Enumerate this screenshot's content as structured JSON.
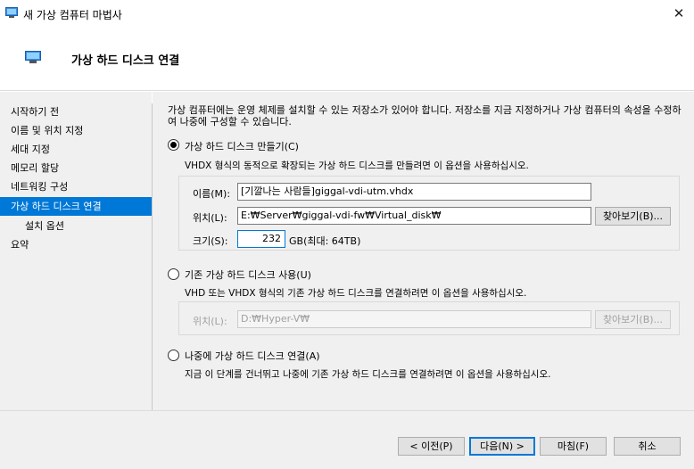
{
  "window": {
    "title": "새 가상 컴퓨터 마법사",
    "close_glyph": "✕"
  },
  "header": {
    "title": "가상 하드 디스크 연결"
  },
  "nav": {
    "items": [
      {
        "label": "시작하기 전"
      },
      {
        "label": "이름 및 위치 지정"
      },
      {
        "label": "세대 지정"
      },
      {
        "label": "메모리 할당"
      },
      {
        "label": "네트워킹 구성"
      },
      {
        "label": "가상 하드 디스크 연결",
        "active": true
      },
      {
        "label": "설치 옵션"
      },
      {
        "label": "요약"
      }
    ]
  },
  "main": {
    "intro": "가상 컴퓨터에는 운영 체제를 설치할 수 있는 저장소가 있어야 합니다. 저장소를 지금 지정하거나 가상 컴퓨터의 속성을 수정하여 나중에 구성할 수 있습니다.",
    "create": {
      "label": "가상 하드 디스크 만들기(C)",
      "selected": true,
      "desc": "VHDX 형식의 동적으로 확장되는 가상 하드 디스크를 만들려면 이 옵션을 사용하십시오.",
      "name_label": "이름(M):",
      "name_value": "[기깔나는 사람들]giggal-vdi-utm.vhdx",
      "location_label": "위치(L):",
      "location_value": "E:₩Server₩giggal-vdi-fw₩Virtual_disk₩",
      "browse_label": "찾아보기(B)...",
      "size_label": "크기(S):",
      "size_value": "232",
      "size_unit": "GB(최대: 64TB)"
    },
    "existing": {
      "label": "기존 가상 하드 디스크 사용(U)",
      "selected": false,
      "desc": "VHD 또는 VHDX 형식의 기존 가상 하드 디스크를 연결하려면 이 옵션을 사용하십시오.",
      "location_label": "위치(L):",
      "location_value": "D:₩Hyper-V₩",
      "browse_label": "찾아보기(B)..."
    },
    "later": {
      "label": "나중에 가상 하드 디스크 연결(A)",
      "selected": false,
      "desc": "지금 이 단계를 건너뛰고 나중에 기존 가상 하드 디스크를 연결하려면 이 옵션을 사용하십시오."
    }
  },
  "footer": {
    "prev_label": "< 이전(P)",
    "next_label": "다음(N) >",
    "finish_label": "마침(F)",
    "cancel_label": "취소"
  },
  "colors": {
    "accent": "#0078d7",
    "panel": "#f0f0f0"
  },
  "icons": {
    "window": "hyperv-monitor-icon",
    "close": "close-icon"
  }
}
